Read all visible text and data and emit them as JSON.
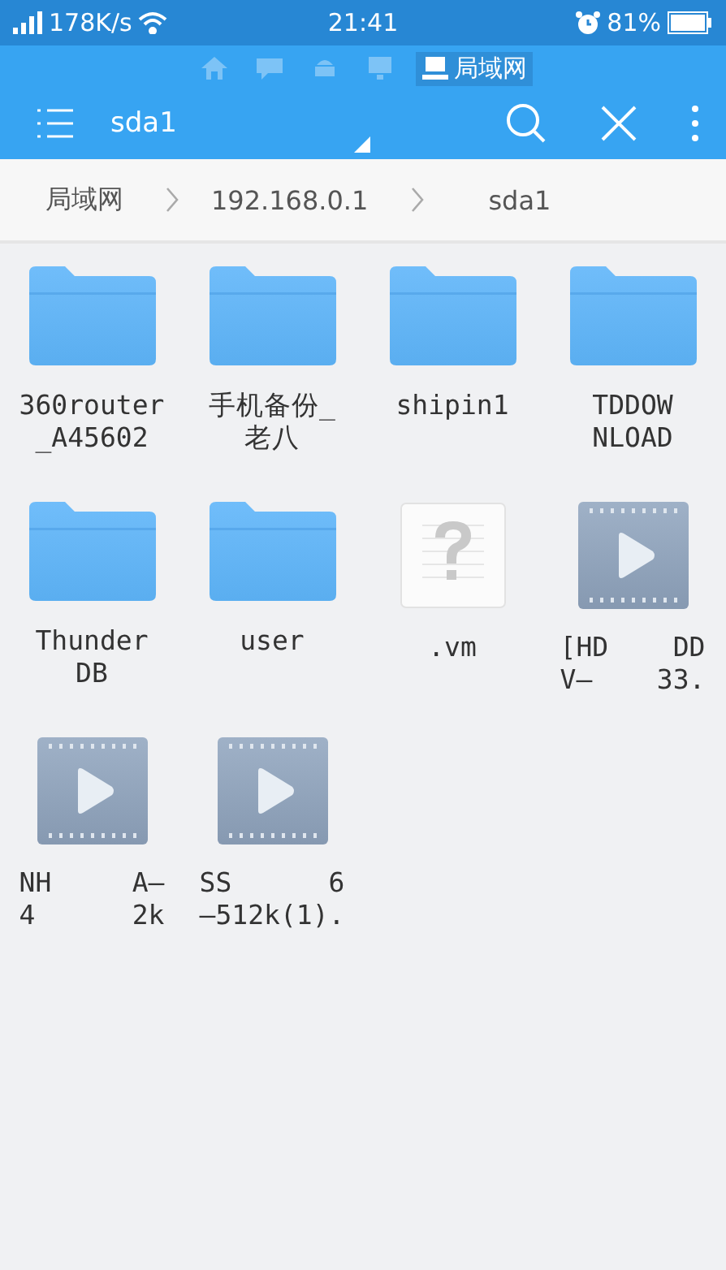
{
  "status_bar": {
    "network_speed": "178K/s",
    "time": "21:41",
    "battery": "81%"
  },
  "source_tabs": [
    {
      "kind": "home",
      "selected": false
    },
    {
      "kind": "chat",
      "selected": false
    },
    {
      "kind": "android",
      "selected": false
    },
    {
      "kind": "screen",
      "selected": false
    },
    {
      "kind": "computer",
      "label": "局域网",
      "selected": true
    }
  ],
  "toolbar": {
    "title": "sda1"
  },
  "breadcrumbs": [
    "局域网",
    "192.168.0.1",
    "sda1"
  ],
  "files": [
    {
      "kind": "folder",
      "lines": [
        "360router",
        "_A45602"
      ]
    },
    {
      "kind": "folder",
      "lines": [
        "手机备份_",
        "老八"
      ]
    },
    {
      "kind": "folder",
      "lines": [
        "shipin1"
      ]
    },
    {
      "kind": "folder",
      "lines": [
        "TDDOW",
        "NLOAD"
      ]
    },
    {
      "kind": "folder",
      "lines": [
        "Thunder",
        "DB"
      ]
    },
    {
      "kind": "folder",
      "lines": [
        "user"
      ]
    },
    {
      "kind": "unknown",
      "lines": [
        ".vm"
      ]
    },
    {
      "kind": "video",
      "lines": [
        "[HD    DD",
        "V—    33."
      ]
    },
    {
      "kind": "video",
      "lines": [
        "NH     A—",
        "4      2k"
      ]
    },
    {
      "kind": "video",
      "lines": [
        "SS      6",
        "—512k(1)."
      ]
    }
  ]
}
